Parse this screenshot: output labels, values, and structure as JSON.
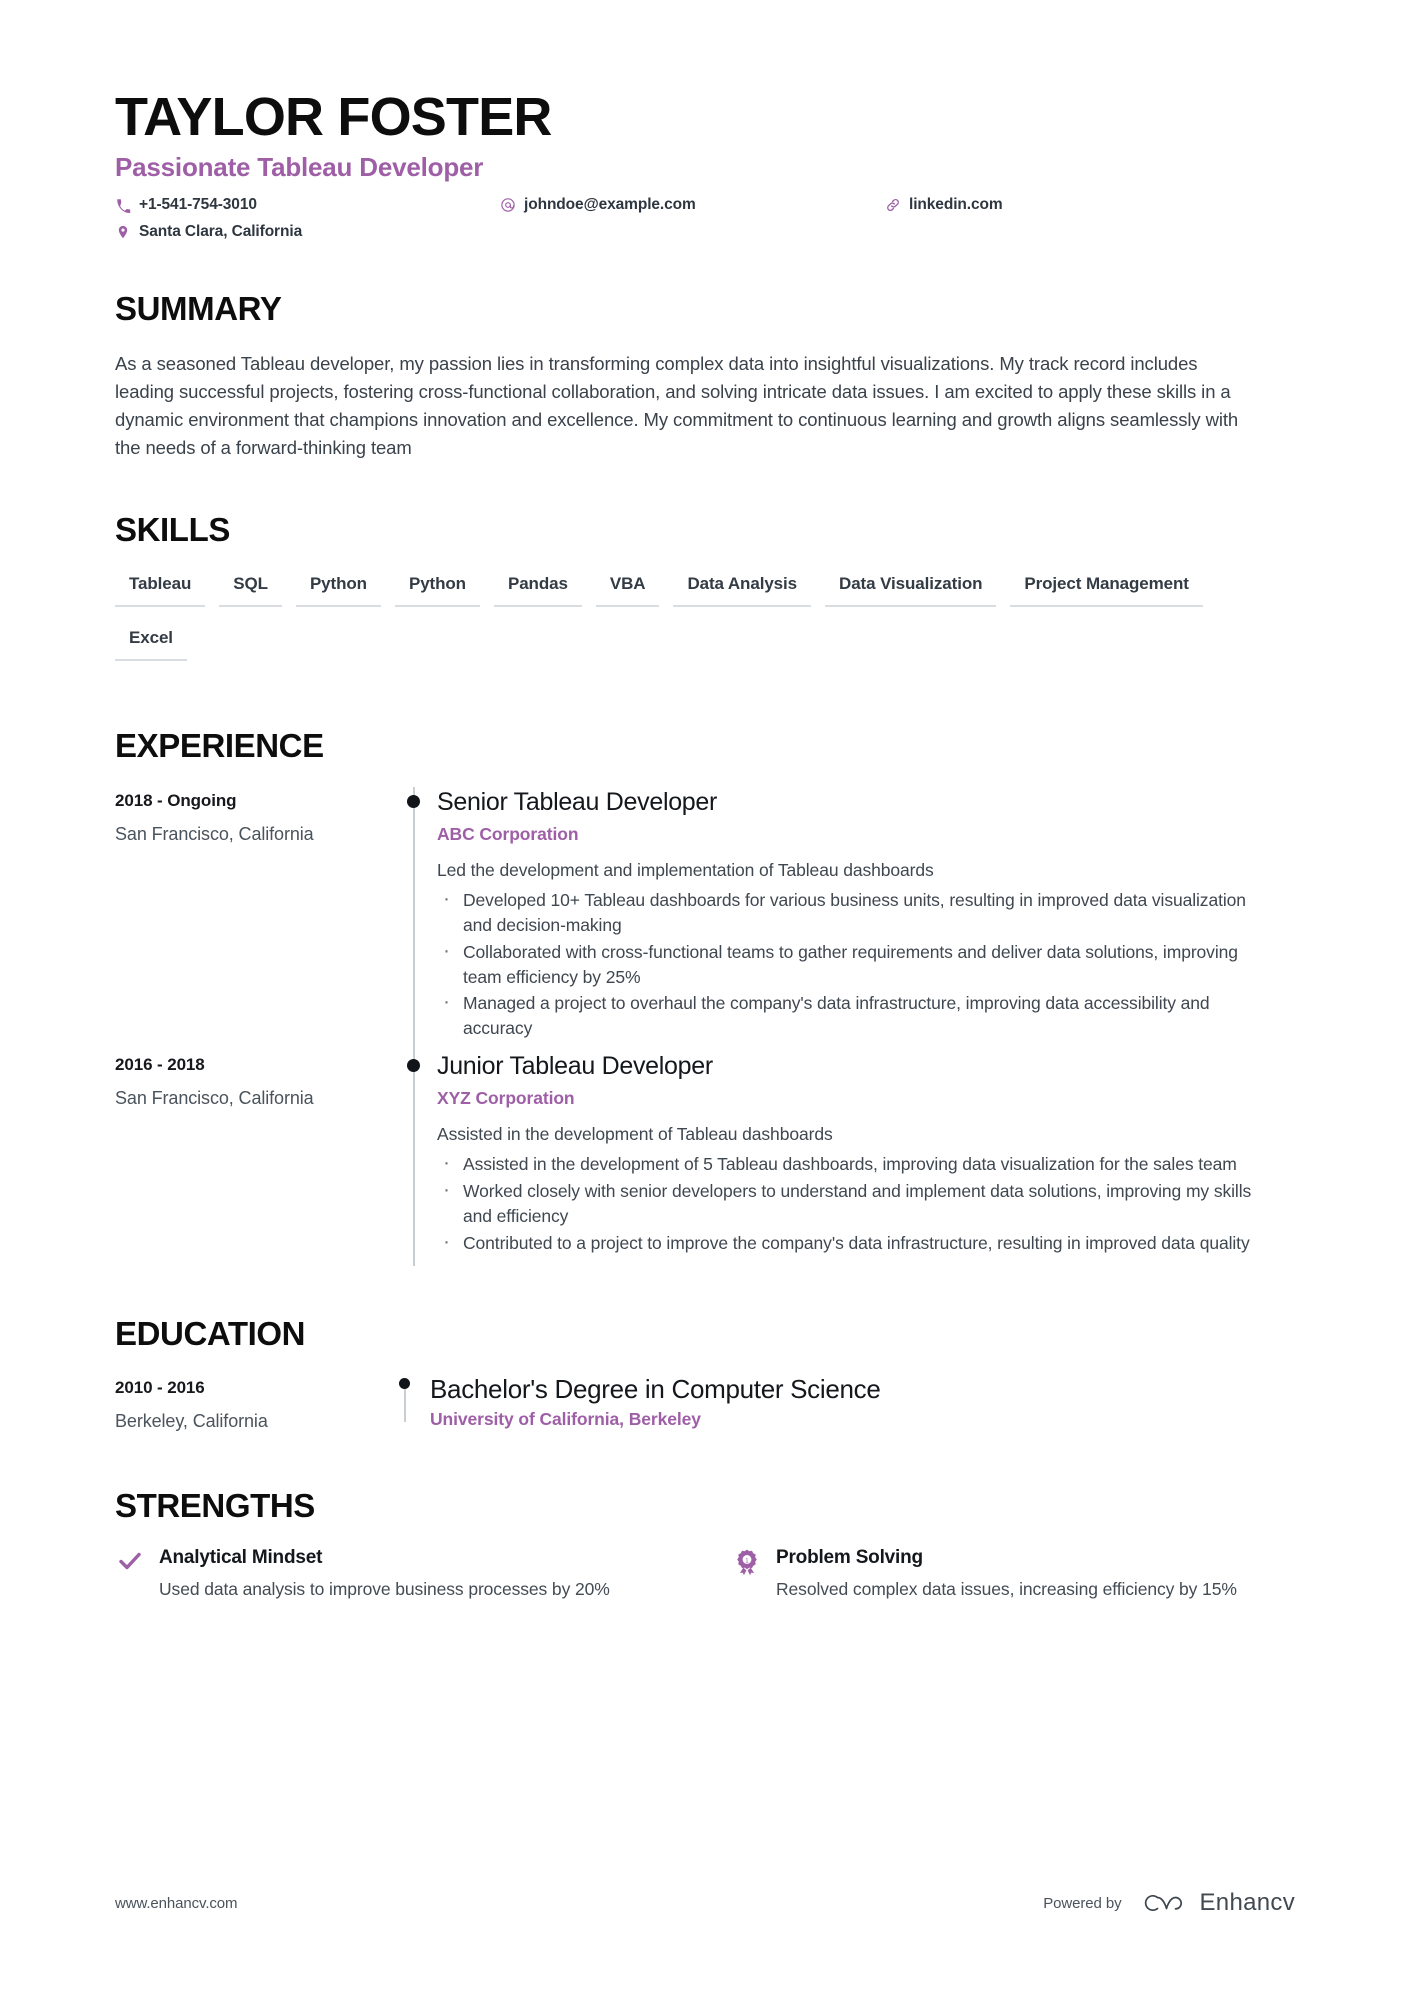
{
  "header": {
    "name": "TAYLOR FOSTER",
    "role": "Passionate Tableau Developer",
    "contacts": [
      {
        "icon": "phone-icon",
        "text": "+1-541-754-3010"
      },
      {
        "icon": "email-icon",
        "text": "johndoe@example.com"
      },
      {
        "icon": "link-icon",
        "text": "linkedin.com"
      },
      {
        "icon": "location-icon",
        "text": "Santa Clara, California"
      }
    ]
  },
  "summary": {
    "title": "SUMMARY",
    "text": "As a seasoned Tableau developer, my passion lies in transforming complex data into insightful visualizations. My track record includes leading successful projects, fostering cross-functional collaboration, and solving intricate data issues. I am excited to apply these skills in a dynamic environment that champions innovation and excellence. My commitment to continuous learning and growth aligns seamlessly with the needs of a forward-thinking team"
  },
  "skills": {
    "title": "SKILLS",
    "items": [
      "Tableau",
      "SQL",
      "Python",
      "Python",
      "Pandas",
      "VBA",
      "Data Analysis",
      "Data Visualization",
      "Project Management",
      "Excel"
    ]
  },
  "experience": {
    "title": "EXPERIENCE",
    "entries": [
      {
        "date": "2018 - Ongoing",
        "location": "San Francisco, California",
        "title": "Senior Tableau Developer",
        "organization": "ABC Corporation",
        "description": "Led the development and implementation of Tableau dashboards",
        "bullets": [
          "Developed 10+ Tableau dashboards for various business units, resulting in improved data visualization and decision-making",
          "Collaborated with cross-functional teams to gather requirements and deliver data solutions, improving team efficiency by 25%",
          "Managed a project to overhaul the company's data infrastructure, improving data accessibility and accuracy"
        ]
      },
      {
        "date": "2016 - 2018",
        "location": "San Francisco, California",
        "title": "Junior Tableau Developer",
        "organization": "XYZ Corporation",
        "description": "Assisted in the development of Tableau dashboards",
        "bullets": [
          "Assisted in the development of 5 Tableau dashboards, improving data visualization for the sales team",
          "Worked closely with senior developers to understand and implement data solutions, improving my skills and efficiency",
          "Contributed to a project to improve the company's data infrastructure, resulting in improved data quality"
        ]
      }
    ]
  },
  "education": {
    "title": "EDUCATION",
    "entries": [
      {
        "date": "2010 - 2016",
        "location": "Berkeley, California",
        "title": "Bachelor's Degree in Computer Science",
        "organization": "University of California, Berkeley"
      }
    ]
  },
  "strengths": {
    "title": "STRENGTHS",
    "items": [
      {
        "icon": "check-icon",
        "title": "Analytical Mindset",
        "description": "Used data analysis to improve business processes by 20%"
      },
      {
        "icon": "award-icon",
        "title": "Problem Solving",
        "description": "Resolved complex data issues, increasing efficiency by 15%"
      }
    ]
  },
  "footer": {
    "url": "www.enhancv.com",
    "powered_by": "Powered by",
    "brand": "Enhancv"
  },
  "colors": {
    "accent": "#9e5fa6",
    "heading": "#0d0d0d",
    "body": "#3a424b",
    "rule": "#d9dde1"
  }
}
